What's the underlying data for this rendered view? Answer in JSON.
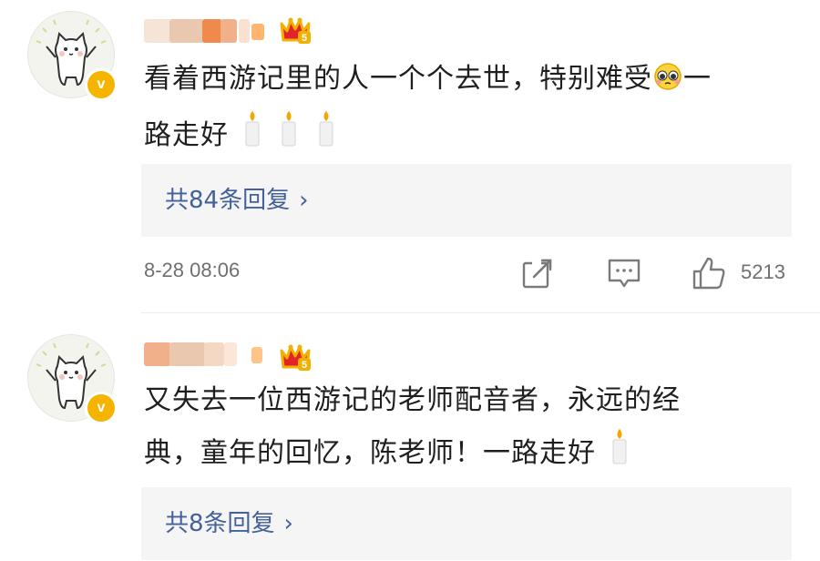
{
  "comments": [
    {
      "text_line1": "看着西游记里的人一个个去世，特别难受",
      "text_line1_end": "一",
      "text_line2": "路走好",
      "replies_label": "共84条回复",
      "time": "8-28 08:06",
      "likes": "5213",
      "verify_badge": "v"
    },
    {
      "text_line1": "又失去一位西游记的老师配音者，永远的经",
      "text_line2": "典，童年的回忆，陈老师！一路走好",
      "replies_label": "共8条回复",
      "verify_badge": "v"
    }
  ],
  "icons": {
    "chevron": "›",
    "crown_level": "5"
  },
  "colors": {
    "link": "#44619c",
    "reply_bg": "#f5f5f5",
    "badge": "#f5b400",
    "crown": "#e3222a"
  }
}
